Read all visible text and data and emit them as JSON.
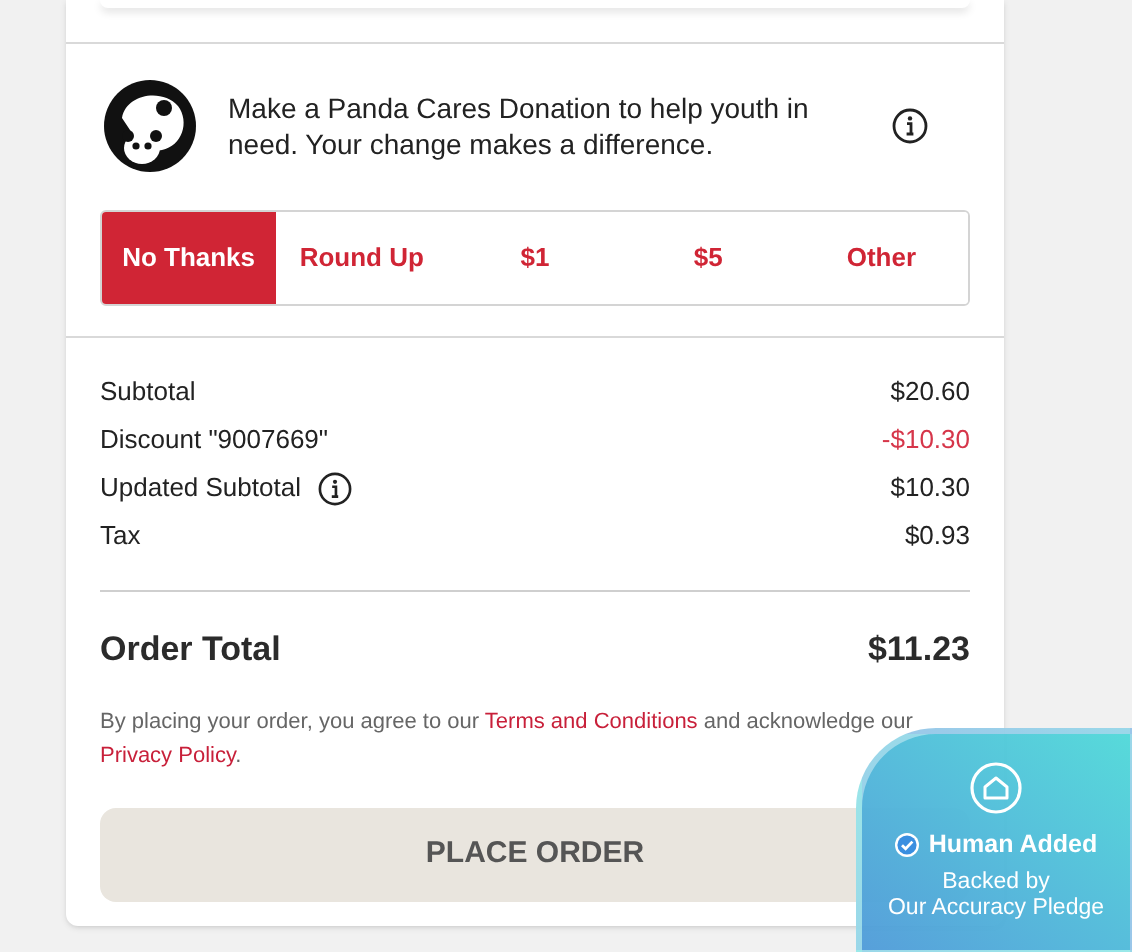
{
  "donation": {
    "message": "Make a Panda Cares Donation to help youth in need. Your change makes a difference.",
    "options": [
      {
        "label": "No Thanks",
        "selected": true
      },
      {
        "label": "Round Up",
        "selected": false
      },
      {
        "label": "$1",
        "selected": false
      },
      {
        "label": "$5",
        "selected": false
      },
      {
        "label": "Other",
        "selected": false
      }
    ]
  },
  "summary": [
    {
      "label": "Subtotal",
      "value": "$20.60",
      "kind": "plain",
      "info": false
    },
    {
      "label": "Discount \"9007669\"",
      "value": "-$10.30",
      "kind": "discount",
      "info": false
    },
    {
      "label": "Updated Subtotal",
      "value": "$10.30",
      "kind": "plain",
      "info": true
    },
    {
      "label": "Tax",
      "value": "$0.93",
      "kind": "plain",
      "info": false
    }
  ],
  "order_total": {
    "label": "Order Total",
    "value": "$11.23"
  },
  "terms": [
    {
      "text": "By placing your order, you agree to our ",
      "link": false
    },
    {
      "text": "Terms and Conditions",
      "link": true
    },
    {
      "text": " and acknowledge our ",
      "link": false
    },
    {
      "text": "Privacy Policy",
      "link": true
    },
    {
      "text": ".",
      "link": false
    }
  ],
  "place_order_button": "PLACE ORDER",
  "badge": {
    "title": "Human Added",
    "subtitle_lines": [
      "Backed by",
      "Our Accuracy Pledge"
    ]
  }
}
